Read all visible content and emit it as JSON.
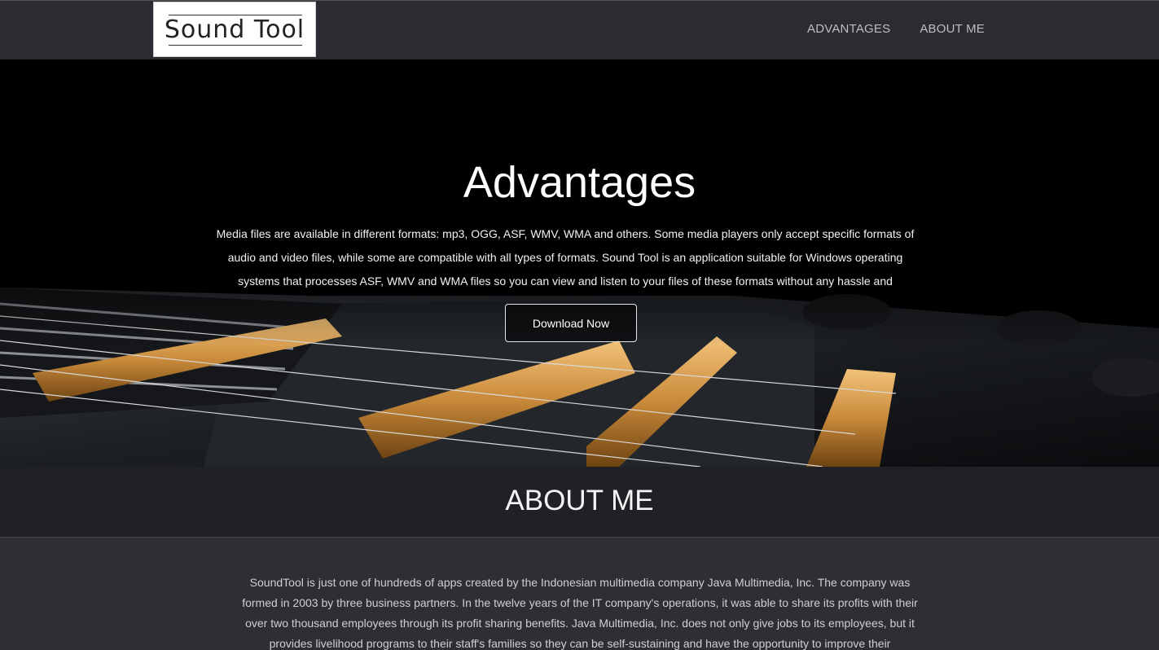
{
  "brand": {
    "logo_text": "Sound Tool"
  },
  "nav": {
    "items": [
      {
        "label": "ADVANTAGES"
      },
      {
        "label": "ABOUT ME"
      }
    ]
  },
  "hero": {
    "title": "Advantages",
    "description": "Media files are available in different formats: mp3, OGG, ASF, WMV, WMA and others. Some media players only accept specific formats of audio and video files, while some are compatible with all types of formats. Sound Tool is an application suitable for Windows operating systems that processes ASF, WMV and WMA files so you can view and listen to your files of these formats without any hassle and",
    "download_label": "Download Now"
  },
  "about": {
    "title": "ABOUT ME",
    "text": "SoundTool is just one of hundreds of apps created by the Indonesian multimedia company Java Multimedia, Inc. The company was formed in 2003 by three business partners. In the twelve years of the IT company's operations, it was able to share its profits with their over two thousand employees through its profit sharing benefits. Java Multimedia, Inc. does not only give jobs to its employees, but it provides livelihood programs to their staff's families so they can be self-sustaining and have the opportunity to improve their"
  },
  "colors": {
    "navbar_bg": "#2b2c32",
    "hero_bg": "#000000",
    "about_header_bg": "#202127",
    "about_body_bg": "#2e2f35",
    "gold_hardware": "#c98a3a"
  }
}
